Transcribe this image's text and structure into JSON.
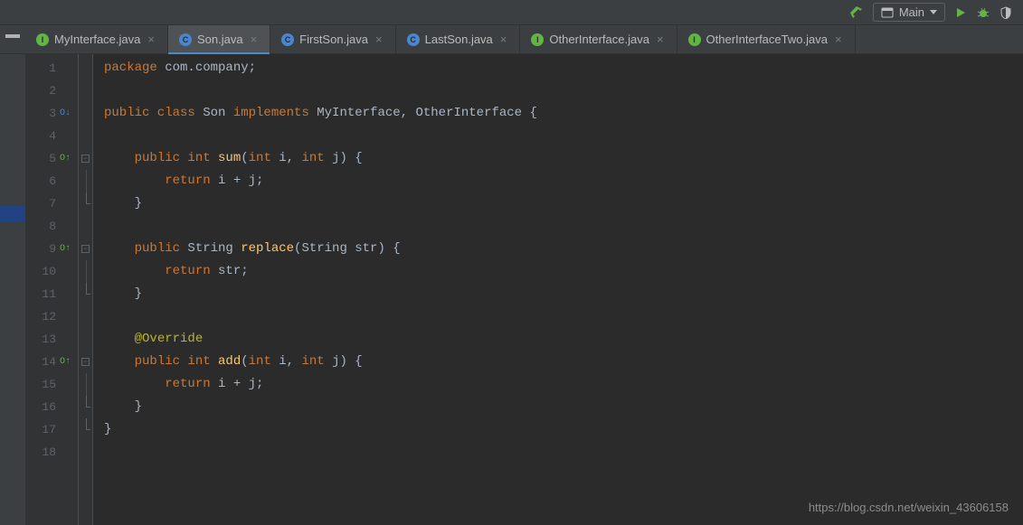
{
  "toolbar": {
    "run_config_label": "Main"
  },
  "tabs": [
    {
      "label": "MyInterface.java",
      "icon": "interface",
      "active": false
    },
    {
      "label": "Son.java",
      "icon": "class",
      "active": true
    },
    {
      "label": "FirstSon.java",
      "icon": "class",
      "active": false
    },
    {
      "label": "LastSon.java",
      "icon": "class",
      "active": false
    },
    {
      "label": "OtherInterface.java",
      "icon": "interface",
      "active": false
    },
    {
      "label": "OtherInterfaceTwo.java",
      "icon": "interface",
      "active": false
    }
  ],
  "gutter": {
    "lines": [
      "1",
      "2",
      "3",
      "4",
      "5",
      "6",
      "7",
      "8",
      "9",
      "10",
      "11",
      "12",
      "13",
      "14",
      "15",
      "16",
      "17",
      "18"
    ],
    "markers": {
      "3": "override-down",
      "5": "implement-up",
      "9": "implement-up",
      "14": "implement-up"
    },
    "folds": {
      "5": "start",
      "6": "mid",
      "7": "end",
      "9": "start",
      "10": "mid",
      "11": "end",
      "14": "start",
      "15": "mid",
      "16": "end",
      "17": "class-end"
    }
  },
  "code": {
    "l1": [
      [
        "keyword",
        "package "
      ],
      [
        "default",
        "com.company;"
      ]
    ],
    "l2": [],
    "l3": [
      [
        "keyword",
        "public class "
      ],
      [
        "default",
        "Son "
      ],
      [
        "keyword",
        "implements "
      ],
      [
        "default",
        "MyInterface, OtherInterface {"
      ]
    ],
    "l4": [],
    "l5": [
      [
        "default",
        "    "
      ],
      [
        "keyword",
        "public int "
      ],
      [
        "method",
        "sum"
      ],
      [
        "default",
        "("
      ],
      [
        "keyword",
        "int "
      ],
      [
        "default",
        "i, "
      ],
      [
        "keyword",
        "int "
      ],
      [
        "default",
        "j) {"
      ]
    ],
    "l6": [
      [
        "default",
        "        "
      ],
      [
        "keyword",
        "return "
      ],
      [
        "default",
        "i + j;"
      ]
    ],
    "l7": [
      [
        "default",
        "    }"
      ]
    ],
    "l8": [],
    "l9": [
      [
        "default",
        "    "
      ],
      [
        "keyword",
        "public "
      ],
      [
        "default",
        "String "
      ],
      [
        "method",
        "replace"
      ],
      [
        "default",
        "(String str) {"
      ]
    ],
    "l10": [
      [
        "default",
        "        "
      ],
      [
        "keyword",
        "return "
      ],
      [
        "default",
        "str;"
      ]
    ],
    "l11": [
      [
        "default",
        "    }"
      ]
    ],
    "l12": [],
    "l13": [
      [
        "default",
        "    "
      ],
      [
        "annotation",
        "@Override"
      ]
    ],
    "l14": [
      [
        "default",
        "    "
      ],
      [
        "keyword",
        "public int "
      ],
      [
        "method",
        "add"
      ],
      [
        "default",
        "("
      ],
      [
        "keyword",
        "int "
      ],
      [
        "default",
        "i, "
      ],
      [
        "keyword",
        "int "
      ],
      [
        "default",
        "j) {"
      ]
    ],
    "l15": [
      [
        "default",
        "        "
      ],
      [
        "keyword",
        "return "
      ],
      [
        "default",
        "i + j;"
      ]
    ],
    "l16": [
      [
        "default",
        "    }"
      ]
    ],
    "l17": [
      [
        "default",
        "}"
      ]
    ],
    "l18": []
  },
  "watermark": "https://blog.csdn.net/weixin_43606158"
}
